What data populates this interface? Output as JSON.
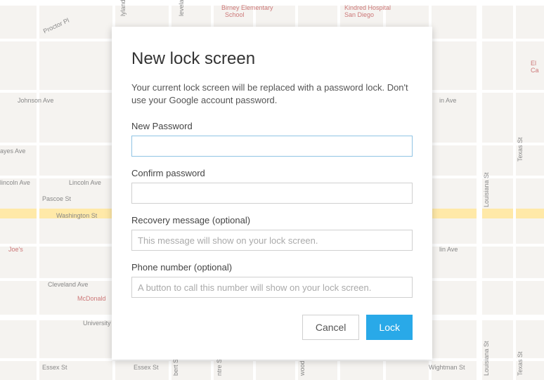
{
  "dialog": {
    "title": "New lock screen",
    "description": "Your current lock screen will be replaced with a password lock. Don't use your Google account password.",
    "fields": {
      "newPassword": {
        "label": "New Password",
        "value": ""
      },
      "confirmPassword": {
        "label": "Confirm password",
        "value": ""
      },
      "recoveryMessage": {
        "label": "Recovery message (optional)",
        "placeholder": "This message will show on your lock screen.",
        "value": ""
      },
      "phoneNumber": {
        "label": "Phone number (optional)",
        "placeholder": "A button to call this number will show on your lock screen.",
        "value": ""
      }
    },
    "actions": {
      "cancel": "Cancel",
      "lock": "Lock"
    }
  },
  "map": {
    "labels": {
      "proctorPl": "Proctor Pl",
      "johnsonAve": "Johnson Ave",
      "ayesAve": "ayes Ave",
      "lincolnAve": "lincoln Ave",
      "lincolnAve2": "Lincoln Ave",
      "pascoeSt": "Pascoe St",
      "washingtonSt": "Washington St",
      "joes": "Joe's",
      "clevelandAve": "Cleveland Ave",
      "mcdonald": "McDonald",
      "university": "University",
      "essexSt": "Essex St",
      "essexSt2": "Essex St",
      "lylandAve": "lyland Ave",
      "levelandAve": "leveland Ave",
      "birney": "Birney Elementary",
      "school": "School",
      "kindred": "Kindred Hospital",
      "sanDiego": "San Diego",
      "elCa": "El Ca",
      "inAve": "in Ave",
      "linAve": "lin Ave",
      "wightmanSt": "Wightman St",
      "textAs": "Texas St",
      "louisiana": "Louisiana St",
      "bertSt": "bert St",
      "ntreSt": "ntre St",
      "woodSt": "wood St"
    }
  }
}
